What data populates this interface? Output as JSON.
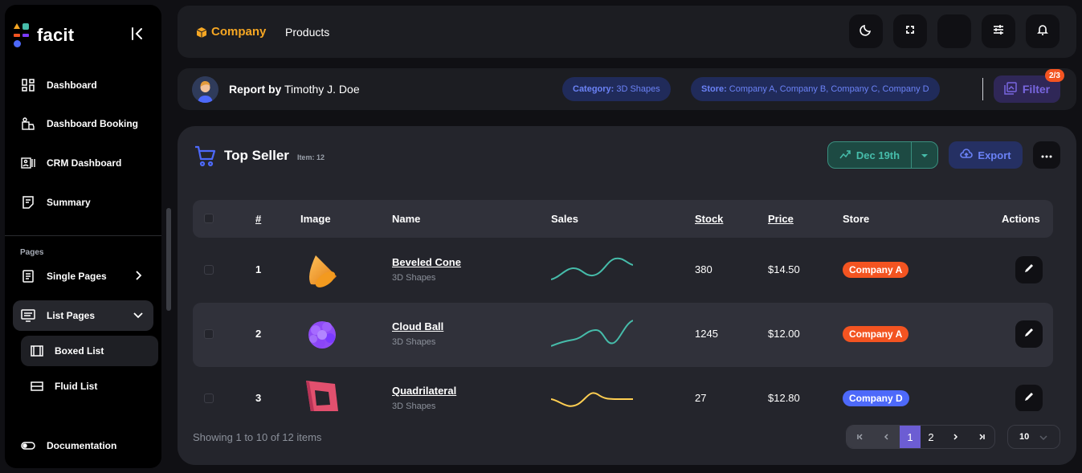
{
  "brand": {
    "name": "facit"
  },
  "sidebar": {
    "items": [
      {
        "label": "Dashboard",
        "icon": "dashboard-icon"
      },
      {
        "label": "Dashboard Booking",
        "icon": "booking-icon"
      },
      {
        "label": "CRM Dashboard",
        "icon": "crm-icon"
      },
      {
        "label": "Summary",
        "icon": "summary-icon"
      }
    ],
    "section": "Pages",
    "pages": [
      {
        "label": "Single Pages",
        "icon": "single-pages-icon"
      },
      {
        "label": "List Pages",
        "icon": "list-pages-icon"
      }
    ],
    "sub_items": [
      {
        "label": "Boxed List",
        "icon": "boxed-list-icon"
      },
      {
        "label": "Fluid List",
        "icon": "fluid-list-icon"
      }
    ],
    "footer_item": {
      "label": "Documentation",
      "icon": "toggle-icon"
    }
  },
  "header": {
    "breadcrumb_company": "Company",
    "breadcrumb_products": "Products"
  },
  "subheader": {
    "report_prefix": "Report by",
    "report_author": "Timothy J. Doe",
    "chips": [
      {
        "key": "Category:",
        "value": "3D Shapes"
      },
      {
        "key": "Store:",
        "value": "Company A, Company B, Company C, Company D"
      }
    ],
    "filter_label": "Filter",
    "filter_badge": "2/3"
  },
  "card": {
    "title": "Top Seller",
    "count": "Item: 12",
    "date_label": "Dec 19th",
    "export_label": "Export"
  },
  "table": {
    "columns": [
      "#",
      "Image",
      "Name",
      "Sales",
      "Stock",
      "Price",
      "Store",
      "Actions"
    ],
    "rows": [
      {
        "id": "1",
        "name": "Beveled Cone",
        "category": "3D Shapes",
        "stock": "380",
        "price": "$14.50",
        "store": "Company A",
        "store_color": "#f35421",
        "spark_color": "#46bcaa"
      },
      {
        "id": "2",
        "name": "Cloud Ball",
        "category": "3D Shapes",
        "stock": "1245",
        "price": "$12.00",
        "store": "Company A",
        "store_color": "#f35421",
        "spark_color": "#46bcaa"
      },
      {
        "id": "3",
        "name": "Quadrilateral",
        "category": "3D Shapes",
        "stock": "27",
        "price": "$12.80",
        "store": "Company D",
        "store_color": "#4d69fa",
        "spark_color": "#ffcf52"
      }
    ]
  },
  "footer": {
    "showing": "Showing 1 to 10 of 12 items",
    "pages": [
      "1",
      "2"
    ],
    "per_page": "10"
  },
  "colors": {
    "accent": "#6c5dd3",
    "success": "#46bcaa",
    "warning": "#f5a623",
    "danger": "#f35421",
    "info": "#4d69fa"
  }
}
